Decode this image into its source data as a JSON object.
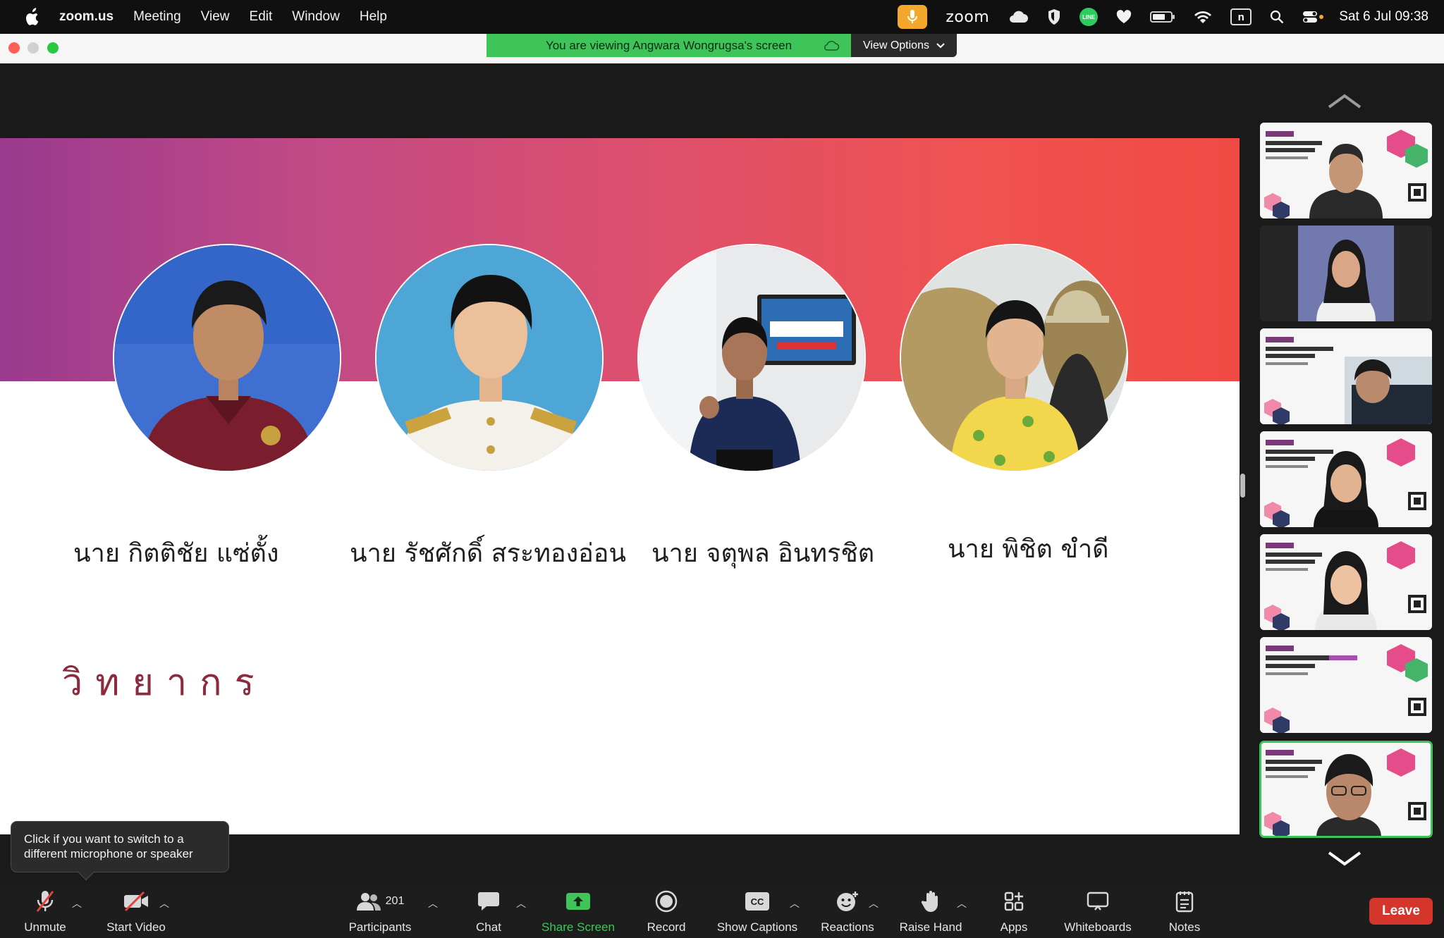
{
  "menubar": {
    "app_name": "zoom.us",
    "items": [
      "Meeting",
      "View",
      "Edit",
      "Window",
      "Help"
    ],
    "zoom_word": "zoom",
    "line_text": "LINE",
    "n_key": "n",
    "clock": "Sat 6 Jul  09:38"
  },
  "banner": {
    "viewing_text": "You are viewing Angwara Wongrugsa's screen",
    "view_options_label": "View Options"
  },
  "slide": {
    "title": "วิทยากร",
    "speakers": [
      {
        "name": "นาย กิตติชัย แซ่ตั้ง"
      },
      {
        "name": "นาย รัชศักดิ์ สระทองอ่อน"
      },
      {
        "name": "นาย จตุพล อินทรชิต"
      },
      {
        "name": "นาย พิชิต ขำดี"
      }
    ]
  },
  "tooltip": {
    "text": "Click if you want to switch to a different microphone or speaker"
  },
  "toolbar": {
    "unmute": "Unmute",
    "start_video": "Start Video",
    "participants": "Participants",
    "participant_count": "201",
    "chat": "Chat",
    "share_screen": "Share Screen",
    "record": "Record",
    "captions_icon": "CC",
    "show_captions": "Show Captions",
    "reactions": "Reactions",
    "raise_hand": "Raise Hand",
    "apps": "Apps",
    "whiteboards": "Whiteboards",
    "notes": "Notes",
    "leave": "Leave"
  },
  "colors": {
    "accent_green": "#3fc45a",
    "leave_red": "#d4362c",
    "title_maroon": "#8c2a3e",
    "mic_orange": "#f3a72c"
  }
}
